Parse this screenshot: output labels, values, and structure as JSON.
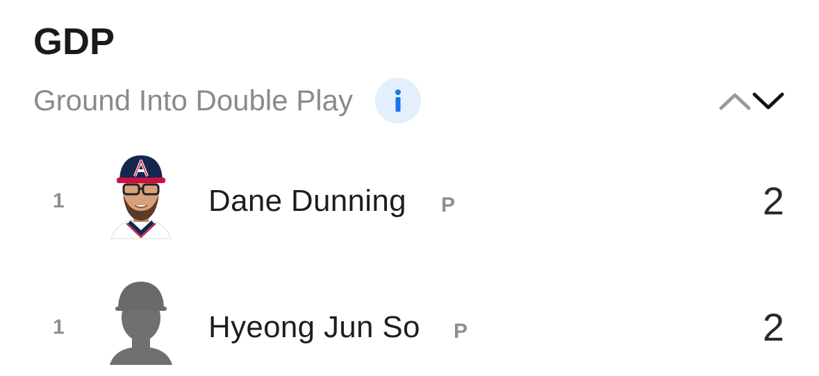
{
  "header": {
    "title": "GDP",
    "subtitle": "Ground Into Double Play",
    "info_icon": "info-icon",
    "sort_up_icon": "chevron-up-icon",
    "sort_down_icon": "chevron-down-icon"
  },
  "colors": {
    "info_bg": "#e3effc",
    "info_fg": "#1a73e8",
    "muted_text": "#8a8a8a",
    "primary_text": "#1e1e1e",
    "cap_navy": "#13274f",
    "cap_red": "#ce1141"
  },
  "leaders": [
    {
      "rank": "1",
      "name": "Dane Dunning",
      "position": "P",
      "value": "2",
      "avatar": "player-headshot"
    },
    {
      "rank": "1",
      "name": "Hyeong Jun So",
      "position": "P",
      "value": "2",
      "avatar": "player-silhouette"
    }
  ]
}
